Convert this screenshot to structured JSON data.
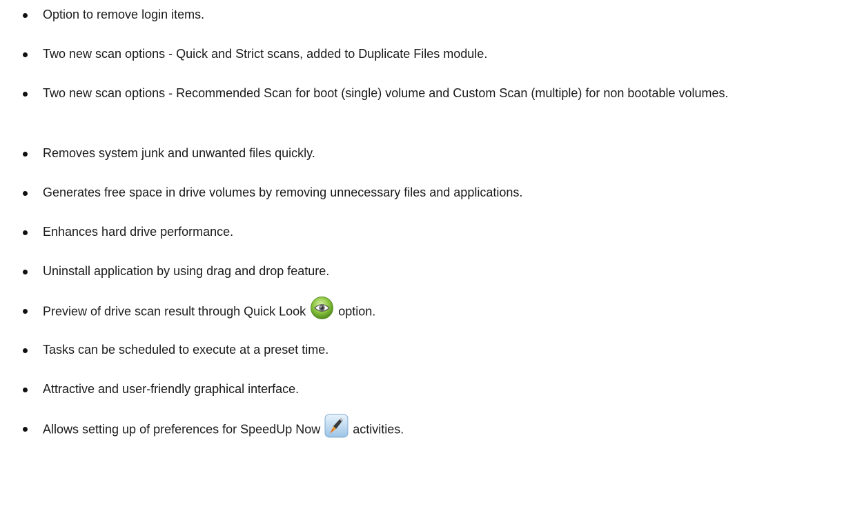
{
  "features": [
    {
      "text": "Option to remove login items."
    },
    {
      "text": "Two new scan options - Quick and Strict scans, added to Duplicate Files module."
    },
    {
      "text": "Two new scan options - Recommended Scan for boot (single) volume and Custom Scan (multiple) for non bootable volumes."
    },
    {
      "text": "Removes system junk and unwanted files quickly."
    },
    {
      "text": "Generates free space in drive volumes by removing unnecessary files and applications."
    },
    {
      "text": "Enhances hard drive performance."
    },
    {
      "text": "Uninstall application by using drag and drop feature."
    },
    {
      "before": "Preview of drive scan result through Quick Look",
      "icon": "eye-icon",
      "after": "option."
    },
    {
      "text": "Tasks can be scheduled to execute at a preset time."
    },
    {
      "text": "Attractive and user-friendly graphical interface."
    },
    {
      "before": "Allows setting up of preferences for SpeedUp Now",
      "icon": "rocket-icon",
      "after": "activities."
    }
  ],
  "colors": {
    "text": "#1a1a1a",
    "eye_icon_green": "#8dc63f",
    "rocket_icon_blue": "#b9d6ee"
  }
}
